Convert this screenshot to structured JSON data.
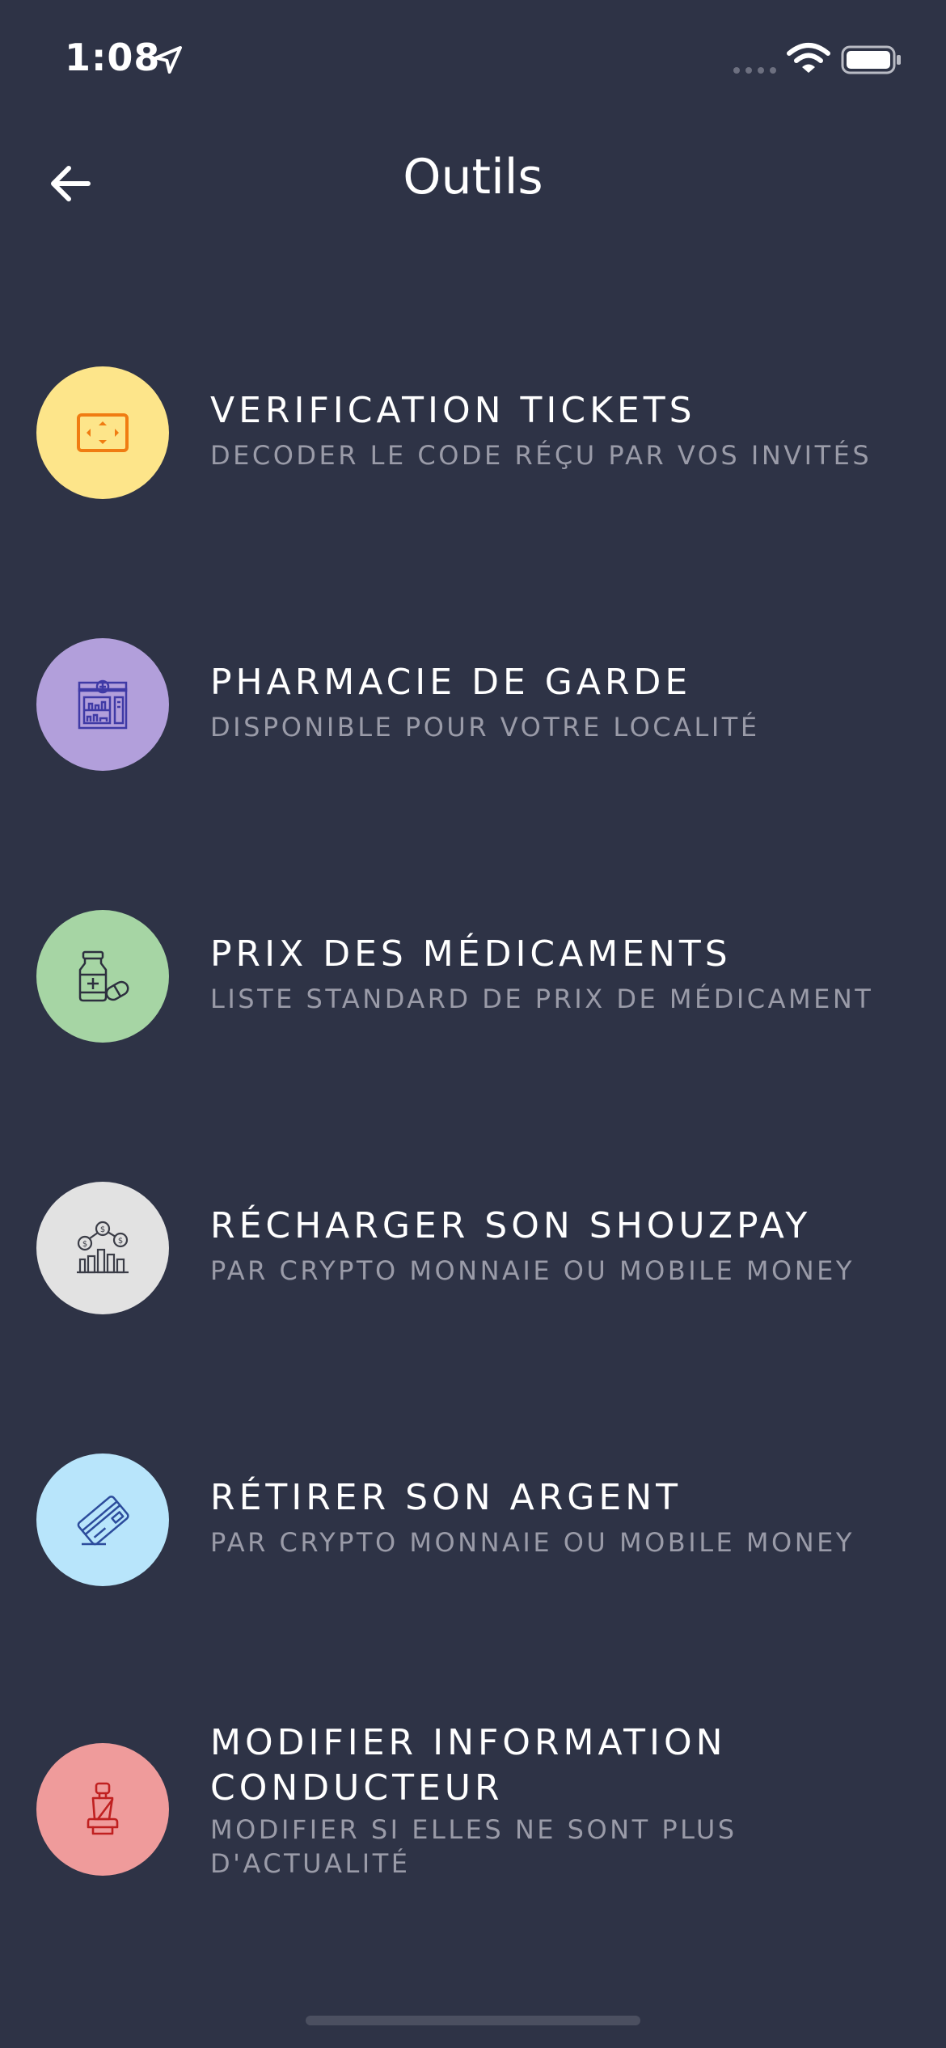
{
  "status_bar": {
    "time": "1:08"
  },
  "header": {
    "title": "Outils"
  },
  "menu": {
    "items": [
      {
        "label": "VERIFICATION TICKETS",
        "sub": "DECODER LE CODE RÉÇU PAR VOS INVITÉS",
        "icon": "ticket-scan-icon",
        "color": "#fde58a"
      },
      {
        "label": "PHARMACIE DE GARDE",
        "sub": "DISPONIBLE POUR VOTRE LOCALITÉ",
        "icon": "pharmacy-store-icon",
        "color": "#b29fdb"
      },
      {
        "label": "PRIX DES MÉDICAMENTS",
        "sub": "LISTE STANDARD DE PRIX DE MÉDICAMENT",
        "icon": "medicine-bottle-icon",
        "color": "#a6d5a4"
      },
      {
        "label": "RÉCHARGER SON SHOUZPAY",
        "sub": "PAR CRYPTO MONNAIE OU MOBILE MONEY",
        "icon": "money-chart-icon",
        "color": "#e2e2e2"
      },
      {
        "label": "RÉTIRER SON ARGENT",
        "sub": "PAR CRYPTO MONNAIE OU MOBILE MONEY",
        "icon": "credit-card-icon",
        "color": "#b8e5fb"
      },
      {
        "label_line1": "MODIFIER INFORMATION",
        "label_line2": "CONDUCTEUR",
        "sub_line1": "MODIFIER SI ELLES NE SONT PLUS",
        "sub_line2": "D'ACTUALITÉ",
        "icon": "car-seat-icon",
        "color": "#ef9b9b"
      }
    ]
  }
}
